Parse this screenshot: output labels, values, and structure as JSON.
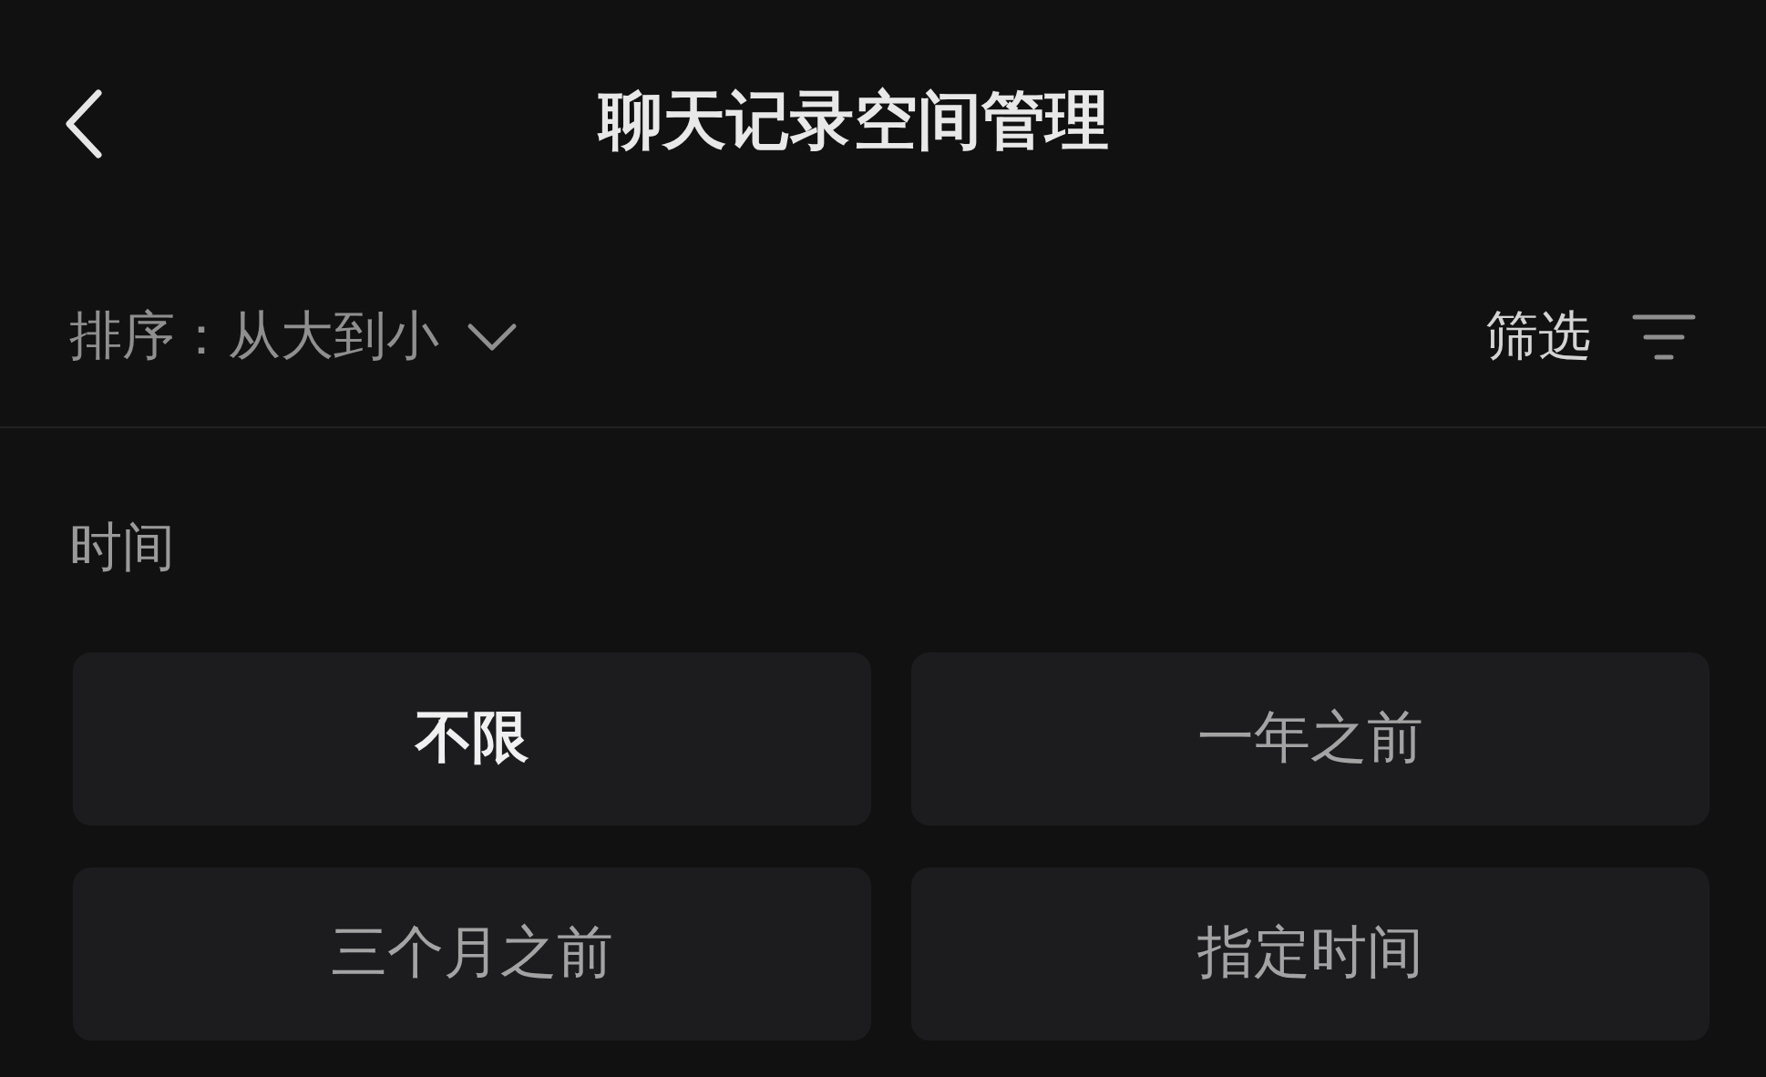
{
  "header": {
    "title": "聊天记录空间管理"
  },
  "sort": {
    "label": "排序：",
    "value": "从大到小"
  },
  "filter": {
    "label": "筛选"
  },
  "time_section": {
    "label": "时间",
    "options": [
      {
        "label": "不限",
        "selected": true
      },
      {
        "label": "一年之前",
        "selected": false
      },
      {
        "label": "三个月之前",
        "selected": false
      },
      {
        "label": "指定时间",
        "selected": false
      }
    ]
  }
}
